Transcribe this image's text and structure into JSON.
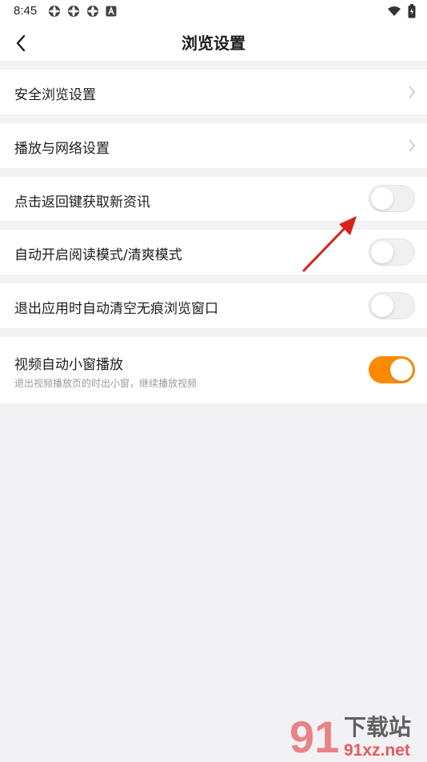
{
  "status_bar": {
    "time": "8:45",
    "left_icons": [
      "app-notification-icon",
      "app-notification-icon",
      "app-notification-icon",
      "a-notification-icon"
    ],
    "right_icons": [
      "wifi-icon",
      "battery-icon"
    ]
  },
  "header": {
    "title": "浏览设置",
    "back_icon": "back-arrow-icon"
  },
  "settings": {
    "safe_browsing": {
      "label": "安全浏览设置",
      "icon": "chevron-right-icon"
    },
    "playback_network": {
      "label": "播放与网络设置",
      "icon": "chevron-right-icon"
    },
    "back_refresh": {
      "label": "点击返回键获取新资讯",
      "enabled": false
    },
    "auto_reader": {
      "label": "自动开启阅读模式/清爽模式",
      "enabled": false
    },
    "clear_incognito": {
      "label": "退出应用时自动清空无痕浏览窗口",
      "enabled": false
    },
    "mini_window": {
      "label": "视频自动小窗播放",
      "sublabel": "退出视频播放页的时出小窗，继续播放视频",
      "enabled": true
    }
  },
  "colors": {
    "accent": "#ff8a00",
    "background": "#f2f2f4",
    "annotation_arrow": "#d9211b",
    "watermark_red": "#e2262b"
  },
  "watermark": {
    "logo_text": "91",
    "title": "下载站",
    "domain": "91xz.net"
  }
}
